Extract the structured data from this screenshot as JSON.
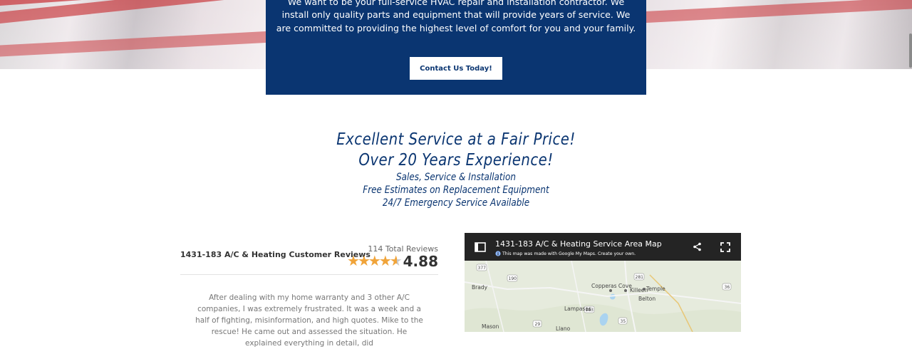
{
  "hero": {
    "intro_text": "We want to be your full-service HVAC repair and installation contractor. We install only quality parts and equipment that will provide years of service. We are committed to providing the highest level of comfort for you and your family.",
    "button_label": "Contact Us Today!"
  },
  "headline": {
    "line1": "Excellent Service at a Fair Price!",
    "line2": "Over 20 Years Experience!",
    "line3": "Sales, Service & Installation",
    "line4": "Free Estimates on Replacement Equipment",
    "line5": "24/7 Emergency Service Available"
  },
  "reviews": {
    "title": "1431-183 A/C & Heating Customer Reviews",
    "total": "114 Total Reviews",
    "rating": "4.88",
    "rating_value": 4.88,
    "star_color": "#f0a43a",
    "review_text": "After dealing with my home warranty and 3 other A/C companies, I was extremely frustrated. It was a week and a half of fighting, misinformation, and high quotes. Mike to the rescue! He came out and assessed the situation. He explained everything in detail, did"
  },
  "map": {
    "title": "1431-183 A/C & Heating Service Area Map",
    "subtitle_prefix": "This map was made with Google My Maps.",
    "subtitle_link": "Create your own.",
    "icons": [
      "map-panel-icon",
      "info-icon",
      "share-icon",
      "fullscreen-icon"
    ],
    "places": [
      "Copperas Cove",
      "Killeen",
      "Temple",
      "Brady",
      "Lampasas",
      "Belton",
      "Mason",
      "Llano"
    ],
    "roads": [
      "377",
      "190",
      "281",
      "183",
      "36",
      "35",
      "29"
    ]
  },
  "colors": {
    "brand_blue": "#0a3571",
    "map_header": "#242424"
  }
}
